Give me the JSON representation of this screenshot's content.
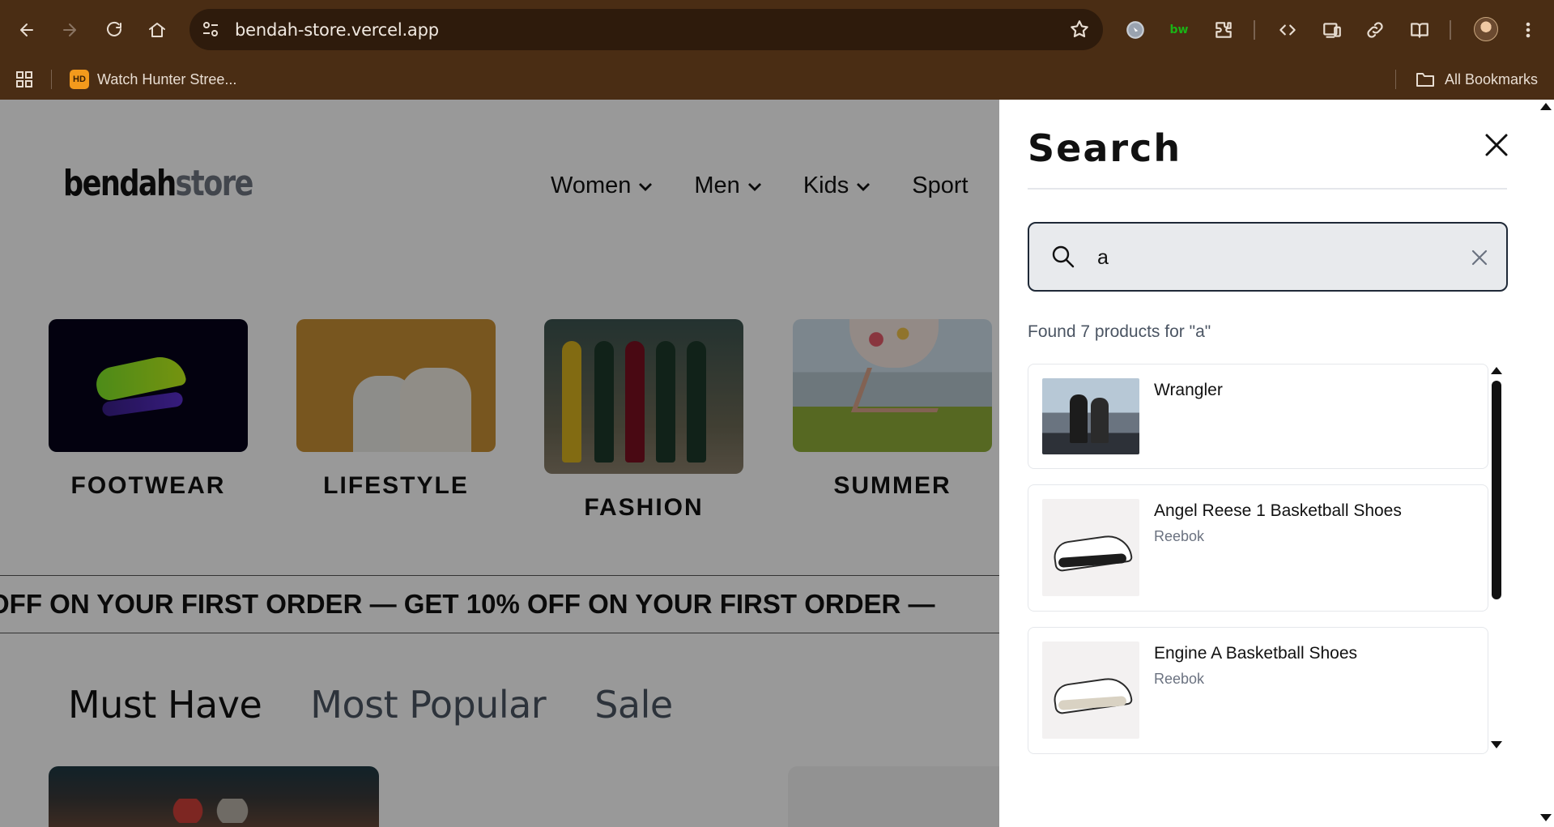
{
  "browser": {
    "url": "bendah-store.vercel.app",
    "extensions": [
      "ext-circle-icon",
      "bitwarden-icon",
      "extensions-puzzle-icon",
      "code-icon",
      "device-icon",
      "link-icon",
      "reading-list-icon"
    ],
    "extension_bw_label": "bw",
    "bookmarks": {
      "item_badge": "HD",
      "item_label": "Watch Hunter Stree...",
      "all_bookmarks": "All Bookmarks"
    }
  },
  "site": {
    "logo_part1": "bendah",
    "logo_part2": "store",
    "nav": [
      {
        "label": "Women"
      },
      {
        "label": "Men"
      },
      {
        "label": "Kids"
      },
      {
        "label": "Sport"
      }
    ],
    "categories": [
      {
        "label": "FOOTWEAR"
      },
      {
        "label": "LIFESTYLE"
      },
      {
        "label": "FASHION"
      },
      {
        "label": "SUMMER"
      }
    ],
    "marquee": "OFF ON YOUR FIRST ORDER — GET 10% OFF ON YOUR FIRST ORDER —",
    "tabs": [
      {
        "label": "Must Have"
      },
      {
        "label": "Most Popular"
      },
      {
        "label": "Sale"
      }
    ]
  },
  "search": {
    "title": "Search",
    "query": "a",
    "results_summary": "Found 7 products for \"a\"",
    "results": [
      {
        "name": "Wrangler",
        "brand": ""
      },
      {
        "name": "Angel Reese 1 Basketball Shoes",
        "brand": "Reebok"
      },
      {
        "name": "Engine A Basketball Shoes",
        "brand": "Reebok"
      }
    ]
  },
  "colors": {
    "chrome": "#4a2d14",
    "omnibox": "#2e1b0c",
    "accent_green": "#1ab316"
  }
}
